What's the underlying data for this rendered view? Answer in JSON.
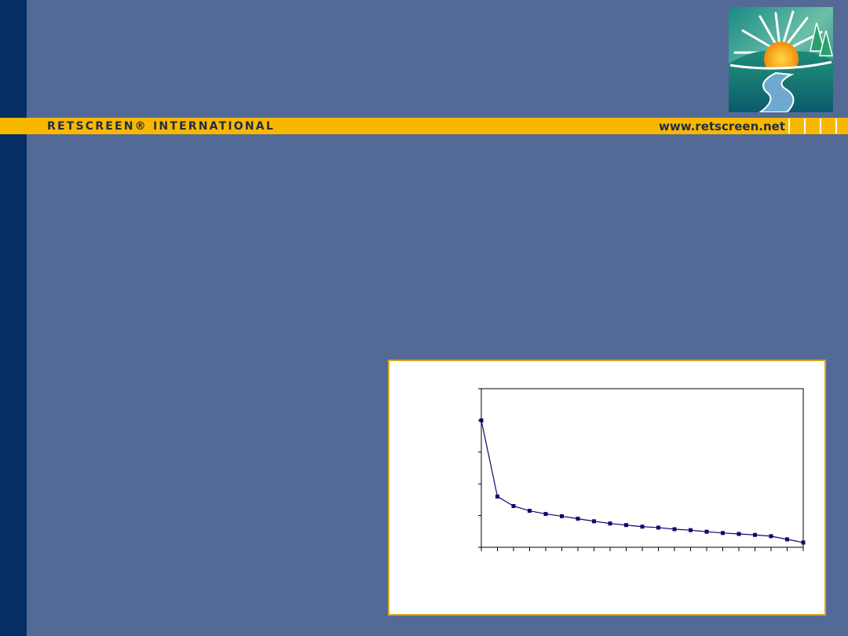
{
  "header": {
    "brand_text": "RETSCREEN® INTERNATIONAL",
    "url_text": "www.retscreen.net"
  },
  "colors": {
    "background": "#536a96",
    "left_bar": "#062d64",
    "gold_band": "#f9b800",
    "line_series": "#0a0a6e"
  },
  "logo": {
    "icon": "sunrise-river-logo-icon"
  },
  "chart_data": {
    "type": "line",
    "title": "",
    "xlabel": "",
    "ylabel": "",
    "x": [
      1,
      2,
      3,
      4,
      5,
      6,
      7,
      8,
      9,
      10,
      11,
      12,
      13,
      14,
      15,
      16,
      17,
      18,
      19,
      20,
      21
    ],
    "series": [
      {
        "values": [
          4.0,
          1.6,
          1.3,
          1.15,
          1.05,
          0.98,
          0.9,
          0.82,
          0.75,
          0.7,
          0.65,
          0.62,
          0.57,
          0.54,
          0.49,
          0.45,
          0.42,
          0.39,
          0.35,
          0.25,
          0.15
        ]
      }
    ],
    "ylim": [
      0,
      5
    ],
    "y_ticks": 5,
    "grid": false,
    "markers": "square"
  }
}
